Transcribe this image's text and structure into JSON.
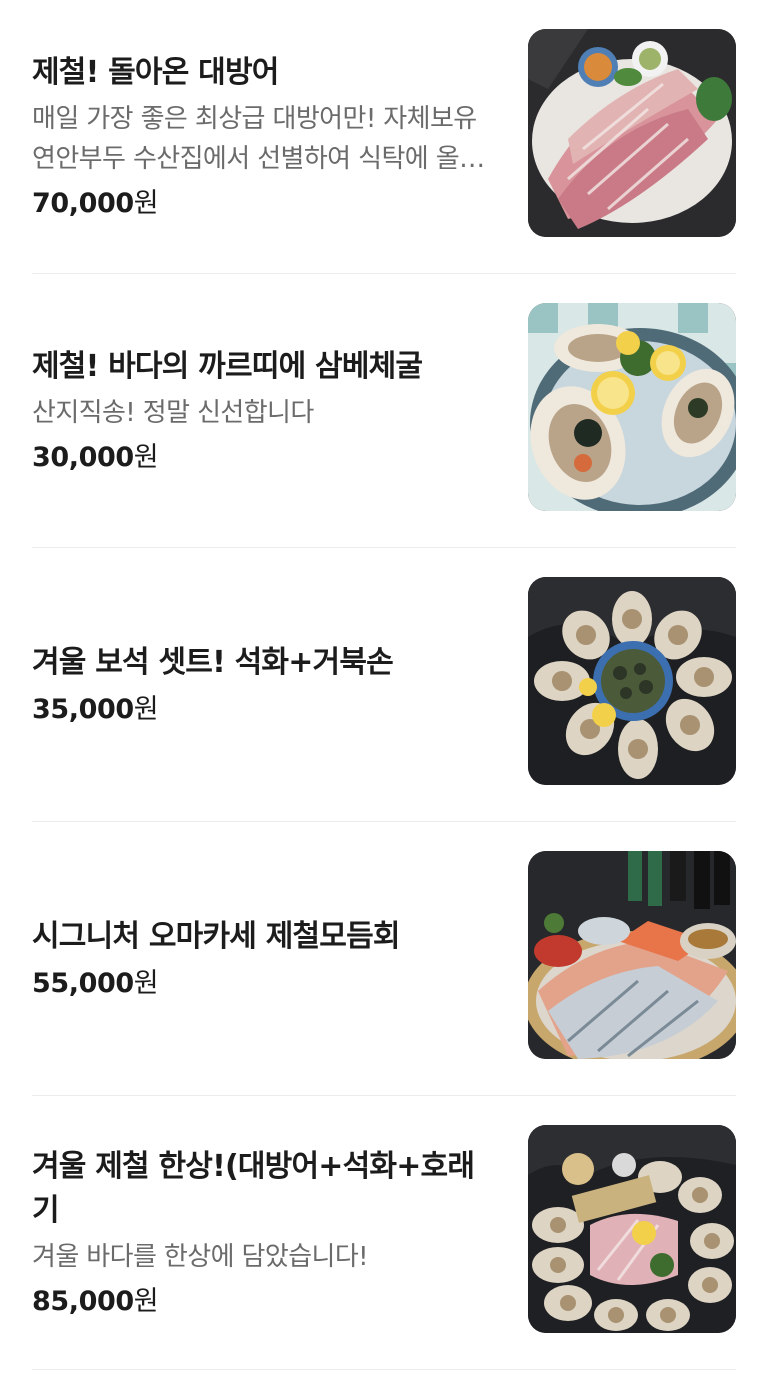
{
  "menu": {
    "items": [
      {
        "name": "제철! 돌아온 대방어",
        "description": "매일 가장 좋은 최상급 대방어만! 자체보유 연안부두 수산집에서 선별하여 식탁에 올립니다",
        "price": "70,000",
        "currency": "원",
        "image": "yellowtail-sashimi-platter-photo"
      },
      {
        "name": "제철! 바다의 까르띠에 삼베체굴",
        "description": "산지직송! 정말 신선합니다",
        "price": "30,000",
        "currency": "원",
        "image": "oysters-with-lemon-photo"
      },
      {
        "name": "겨울 보석 셋트! 석화+거북손",
        "description": "",
        "price": "35,000",
        "currency": "원",
        "image": "oysters-and-gooseneck-barnacles-photo"
      },
      {
        "name": "시그니처 오마카세 제철모듬회",
        "description": "",
        "price": "55,000",
        "currency": "원",
        "image": "assorted-sashimi-omakase-photo"
      },
      {
        "name": "겨울 제철 한상!(대방어+석화+호래기",
        "description": "겨울 바다를 한상에 담았습니다!",
        "price": "85,000",
        "currency": "원",
        "image": "winter-seafood-set-photo"
      }
    ]
  }
}
